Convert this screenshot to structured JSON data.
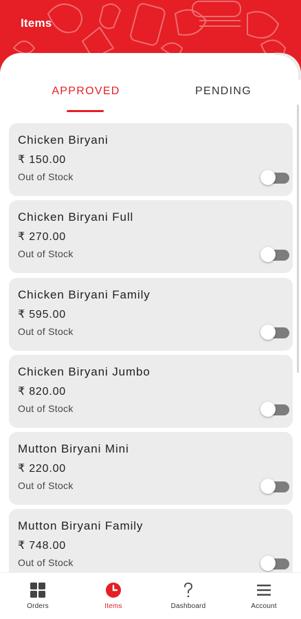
{
  "header": {
    "title": "Items"
  },
  "tabs": [
    {
      "label": "APPROVED",
      "active": true
    },
    {
      "label": "PENDING",
      "active": false
    }
  ],
  "items": [
    {
      "name": "Chicken Biryani",
      "price": "₹ 150.00",
      "status": "Out of Stock",
      "in_stock": false
    },
    {
      "name": "Chicken Biryani Full",
      "price": "₹ 270.00",
      "status": "Out of Stock",
      "in_stock": false
    },
    {
      "name": "Chicken Biryani Family",
      "price": "₹ 595.00",
      "status": "Out of Stock",
      "in_stock": false
    },
    {
      "name": "Chicken Biryani Jumbo",
      "price": "₹ 820.00",
      "status": "Out of Stock",
      "in_stock": false
    },
    {
      "name": "Mutton Biryani Mini",
      "price": "₹ 220.00",
      "status": "Out of Stock",
      "in_stock": false
    },
    {
      "name": "Mutton Biryani Family",
      "price": "₹ 748.00",
      "status": "Out of Stock",
      "in_stock": false
    }
  ],
  "bottom_nav": [
    {
      "label": "Orders",
      "icon": "grid-icon",
      "active": false
    },
    {
      "label": "Items",
      "icon": "clock-icon",
      "active": true
    },
    {
      "label": "Dashboard",
      "icon": "question-icon",
      "active": false
    },
    {
      "label": "Account",
      "icon": "menu-icon",
      "active": false
    }
  ],
  "colors": {
    "accent": "#e61e25",
    "card": "#ececec",
    "toggle_track": "#7d7d7d"
  }
}
